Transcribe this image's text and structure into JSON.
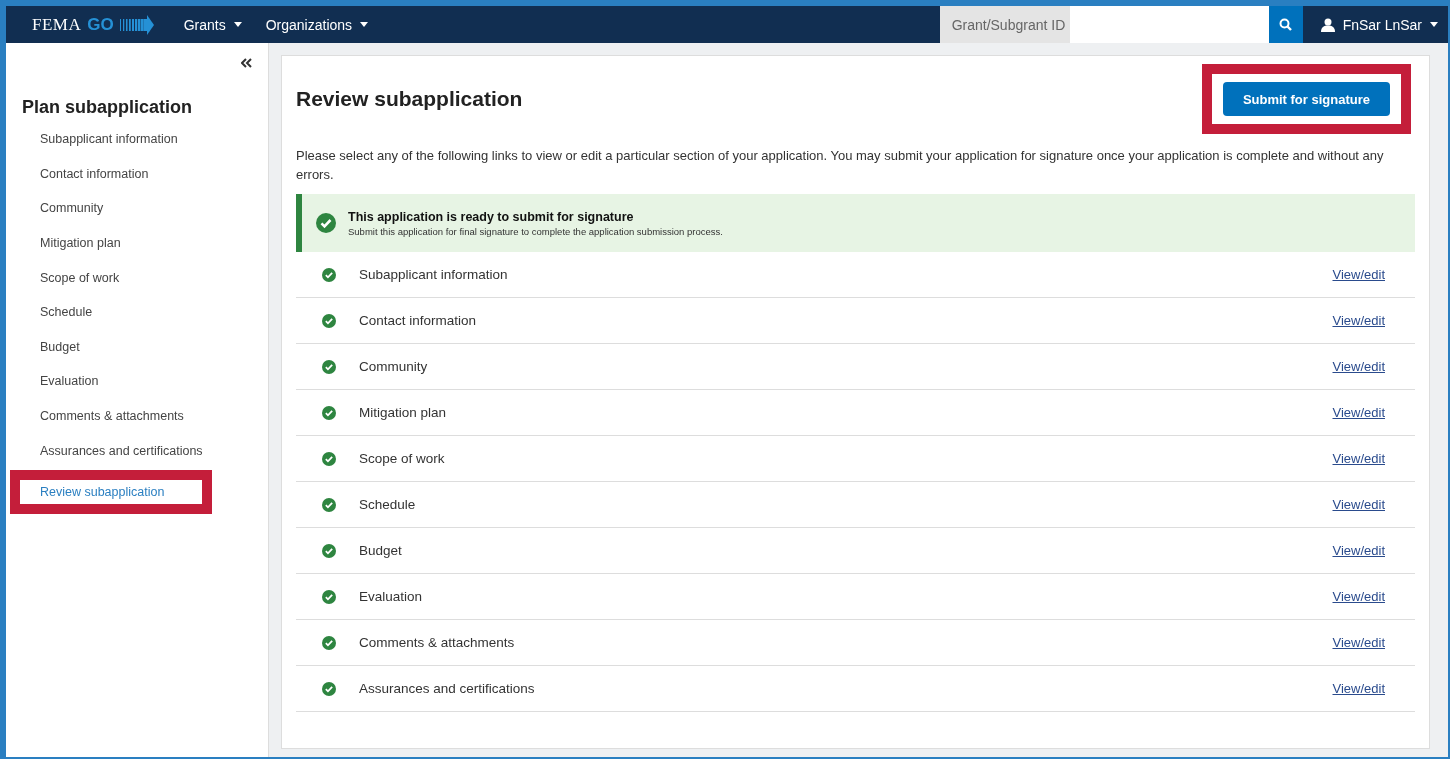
{
  "navbar": {
    "logo": {
      "name": "FEMA",
      "mark": "GO"
    },
    "menus": [
      {
        "label": "Grants"
      },
      {
        "label": "Organizations"
      }
    ],
    "search": {
      "label": "Grant/Subgrant ID"
    },
    "user": {
      "name": "FnSar LnSar"
    }
  },
  "sidebar": {
    "title": "Plan subapplication",
    "items": [
      {
        "label": "Subapplicant information",
        "selected": false,
        "highlighted": false
      },
      {
        "label": "Contact information",
        "selected": false,
        "highlighted": false
      },
      {
        "label": "Community",
        "selected": false,
        "highlighted": false
      },
      {
        "label": "Mitigation plan",
        "selected": false,
        "highlighted": false
      },
      {
        "label": "Scope of work",
        "selected": false,
        "highlighted": false
      },
      {
        "label": "Schedule",
        "selected": false,
        "highlighted": false
      },
      {
        "label": "Budget",
        "selected": false,
        "highlighted": false
      },
      {
        "label": "Evaluation",
        "selected": false,
        "highlighted": false
      },
      {
        "label": "Comments & attachments",
        "selected": false,
        "highlighted": false
      },
      {
        "label": "Assurances and certifications",
        "selected": false,
        "highlighted": false
      },
      {
        "label": "Review subapplication",
        "selected": true,
        "highlighted": true
      }
    ]
  },
  "main": {
    "title": "Review subapplication",
    "submit_button": {
      "label": "Submit for signature",
      "highlighted": true
    },
    "intro": "Please select any of the following links to view or edit a particular section of your application. You may submit your application for signature once your application is complete and without any errors.",
    "alert": {
      "title": "This application is ready to submit for signature",
      "message": "Submit this application for final signature to complete the application submission process."
    },
    "sections": [
      {
        "label": "Subapplicant information",
        "complete": true,
        "link": "View/edit"
      },
      {
        "label": "Contact information",
        "complete": true,
        "link": "View/edit"
      },
      {
        "label": "Community",
        "complete": true,
        "link": "View/edit"
      },
      {
        "label": "Mitigation plan",
        "complete": true,
        "link": "View/edit"
      },
      {
        "label": "Scope of work",
        "complete": true,
        "link": "View/edit"
      },
      {
        "label": "Schedule",
        "complete": true,
        "link": "View/edit"
      },
      {
        "label": "Budget",
        "complete": true,
        "link": "View/edit"
      },
      {
        "label": "Evaluation",
        "complete": true,
        "link": "View/edit"
      },
      {
        "label": "Comments & attachments",
        "complete": true,
        "link": "View/edit"
      },
      {
        "label": "Assurances and certifications",
        "complete": true,
        "link": "View/edit"
      }
    ]
  }
}
